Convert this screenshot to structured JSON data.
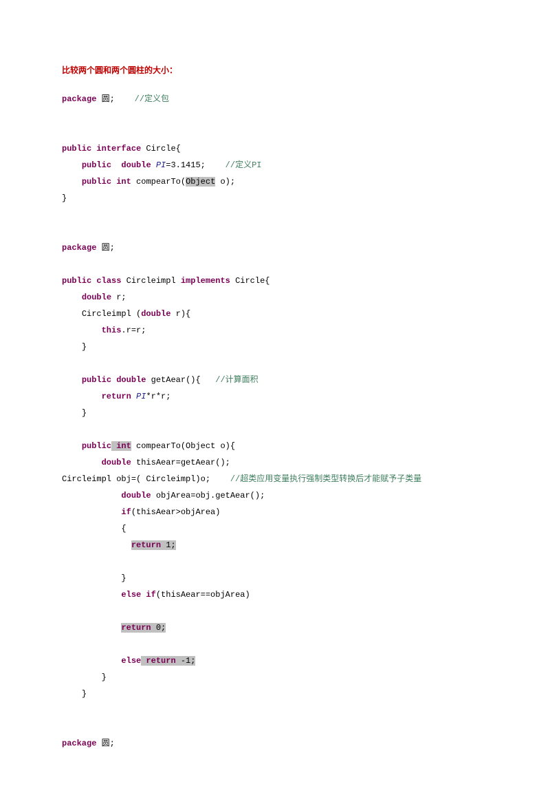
{
  "title": "比较两个圆和两个圆柱的大小：",
  "code": {
    "l1_kw1": "package",
    "l1_id": " 圆;",
    "l1_cmt": "    //定义包",
    "l2_kw1": "public",
    "l2_kw2": " interface",
    "l2_id": " Circle{",
    "l3_kw1": "public",
    "l3_kw2": "  double",
    "l3_pi": " PI",
    "l3_rest": "=3.1415;",
    "l3_cmt": "    //定义PI",
    "l4_kw1": "public",
    "l4_kw2": " int",
    "l4_m": " compearTo(",
    "l4_obj": "Object",
    "l4_m2": " o);",
    "l5": "}",
    "l6_kw1": "package",
    "l6_id": " 圆;",
    "l7_kw1": "public",
    "l7_kw2": " class",
    "l7_cls": " Circleimpl ",
    "l7_kw3": "implements",
    "l7_cls2": " Circle{",
    "l8_kw1": "double",
    "l8_id": " r;",
    "l9_a": "Circleimpl (",
    "l9_kw1": "double",
    "l9_b": " r){",
    "l10_kw1": "this",
    "l10_a": ".r=r;",
    "l11": "}",
    "l12_kw1": "public",
    "l12_kw2": " double",
    "l12_m": " getAear(){",
    "l12_cmt": "   //计算面积",
    "l13_kw1": "return",
    "l13_pi": " PI",
    "l13_rest": "*r*r;",
    "l14": "}",
    "l15_kw1": "public",
    "l15_kw2": " int",
    "l15_m": " compearTo(Object o){",
    "l16_kw1": "double",
    "l16_a": " thisAear=getAear();",
    "l17_a": "Circleimpl obj=( Circleimpl)o;",
    "l17_cmt": "    //超类应用变量执行强制类型转换后才能赋予子类量",
    "l18_kw1": "double",
    "l18_a": " objArea=obj.getAear();",
    "l19_kw1": "if",
    "l19_a": "(thisAear>objArea)",
    "l20": "{",
    "l21_kw1": "return",
    "l21_a": " 1;",
    "l22": "}",
    "l23_kw1": "else",
    "l23_kw2": " if",
    "l23_a": "(thisAear==objArea)",
    "l24_kw1": "return",
    "l24_a": " 0;",
    "l25_kw1": "else",
    "l25_kw2": " return",
    "l25_a": " -1;",
    "l26": "}",
    "l27": "}",
    "l28_kw1": "package",
    "l28_id": " 圆;"
  }
}
